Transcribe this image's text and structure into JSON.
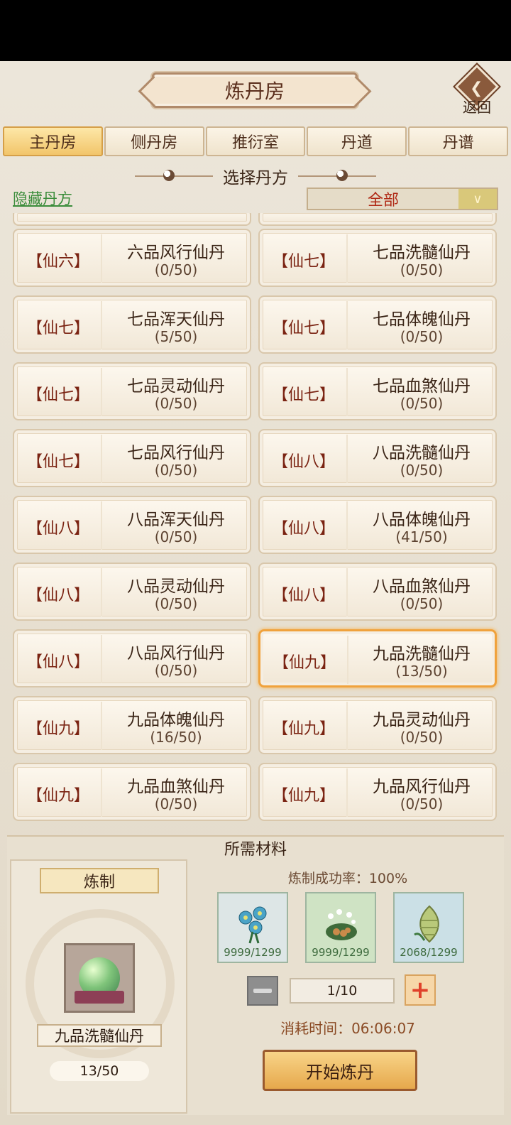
{
  "header": {
    "title": "炼丹房",
    "back_label": "返回"
  },
  "tabs": [
    {
      "label": "主丹房",
      "active": true
    },
    {
      "label": "侧丹房",
      "active": false
    },
    {
      "label": "推衍室",
      "active": false
    },
    {
      "label": "丹道",
      "active": false
    },
    {
      "label": "丹谱",
      "active": false
    }
  ],
  "section_title": "选择丹方",
  "hide_link": "隐藏丹方",
  "filter": {
    "value": "全部",
    "icon": "chevron-double-down-icon"
  },
  "recipes": [
    {
      "grade": "【仙六】",
      "name": "六品风行仙丹",
      "count": "(0/50)"
    },
    {
      "grade": "【仙七】",
      "name": "七品洗髓仙丹",
      "count": "(0/50)"
    },
    {
      "grade": "【仙七】",
      "name": "七品浑天仙丹",
      "count": "(5/50)"
    },
    {
      "grade": "【仙七】",
      "name": "七品体魄仙丹",
      "count": "(0/50)"
    },
    {
      "grade": "【仙七】",
      "name": "七品灵动仙丹",
      "count": "(0/50)"
    },
    {
      "grade": "【仙七】",
      "name": "七品血煞仙丹",
      "count": "(0/50)"
    },
    {
      "grade": "【仙七】",
      "name": "七品风行仙丹",
      "count": "(0/50)"
    },
    {
      "grade": "【仙八】",
      "name": "八品洗髓仙丹",
      "count": "(0/50)"
    },
    {
      "grade": "【仙八】",
      "name": "八品浑天仙丹",
      "count": "(0/50)"
    },
    {
      "grade": "【仙八】",
      "name": "八品体魄仙丹",
      "count": "(41/50)"
    },
    {
      "grade": "【仙八】",
      "name": "八品灵动仙丹",
      "count": "(0/50)"
    },
    {
      "grade": "【仙八】",
      "name": "八品血煞仙丹",
      "count": "(0/50)"
    },
    {
      "grade": "【仙八】",
      "name": "八品风行仙丹",
      "count": "(0/50)"
    },
    {
      "grade": "【仙九】",
      "name": "九品洗髓仙丹",
      "count": "(13/50)",
      "selected": true
    },
    {
      "grade": "【仙九】",
      "name": "九品体魄仙丹",
      "count": "(16/50)"
    },
    {
      "grade": "【仙九】",
      "name": "九品灵动仙丹",
      "count": "(0/50)"
    },
    {
      "grade": "【仙九】",
      "name": "九品血煞仙丹",
      "count": "(0/50)"
    },
    {
      "grade": "【仙九】",
      "name": "九品风行仙丹",
      "count": "(0/50)"
    }
  ],
  "materials": {
    "title": "所需材料",
    "refine_label": "炼制",
    "product_name": "九品洗髓仙丹",
    "product_count": "13/50",
    "success_rate": "炼制成功率：100%",
    "items": [
      {
        "icon": "blue-flower-icon",
        "qty": "9999/1299",
        "bg": "#dde6e6"
      },
      {
        "icon": "nest-herb-icon",
        "qty": "9999/1299",
        "bg": "#cfe3c4"
      },
      {
        "icon": "green-cone-icon",
        "qty": "2068/1299",
        "bg": "#cbe0e6"
      }
    ],
    "quantity": "1/10",
    "time_cost": "消耗时间：06:06:07",
    "start_label": "开始炼丹"
  },
  "colors": {
    "selected_border": "#f0a23c",
    "grade_text": "#7a2312",
    "link_green": "#3a8c3a",
    "filter_red": "#b02a16"
  }
}
